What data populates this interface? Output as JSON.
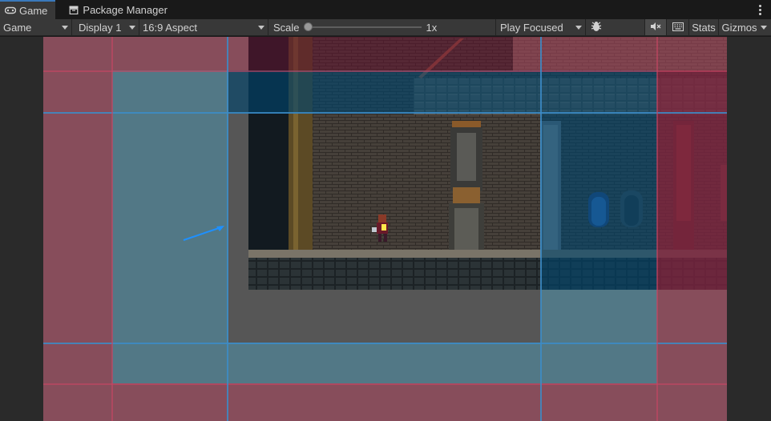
{
  "tabs": [
    {
      "label": "Game",
      "icon": "gamepad-icon",
      "active": true
    },
    {
      "label": "Package Manager",
      "icon": "package-icon",
      "active": false
    }
  ],
  "toolbar": {
    "view_mode": "Game",
    "display": "Display 1",
    "aspect": "16:9 Aspect",
    "scale_label": "Scale",
    "scale_value": "1x",
    "play_mode": "Play Focused",
    "stats_label": "Stats",
    "gizmos_label": "Gizmos"
  },
  "colors": {
    "accent": "#3a79bb",
    "toolbar_bg": "#383838",
    "tab_bg": "#191919",
    "overlay_pink": "#aa465f",
    "overlay_blue": "#5096af",
    "arrow_blue": "#1e90ff"
  }
}
